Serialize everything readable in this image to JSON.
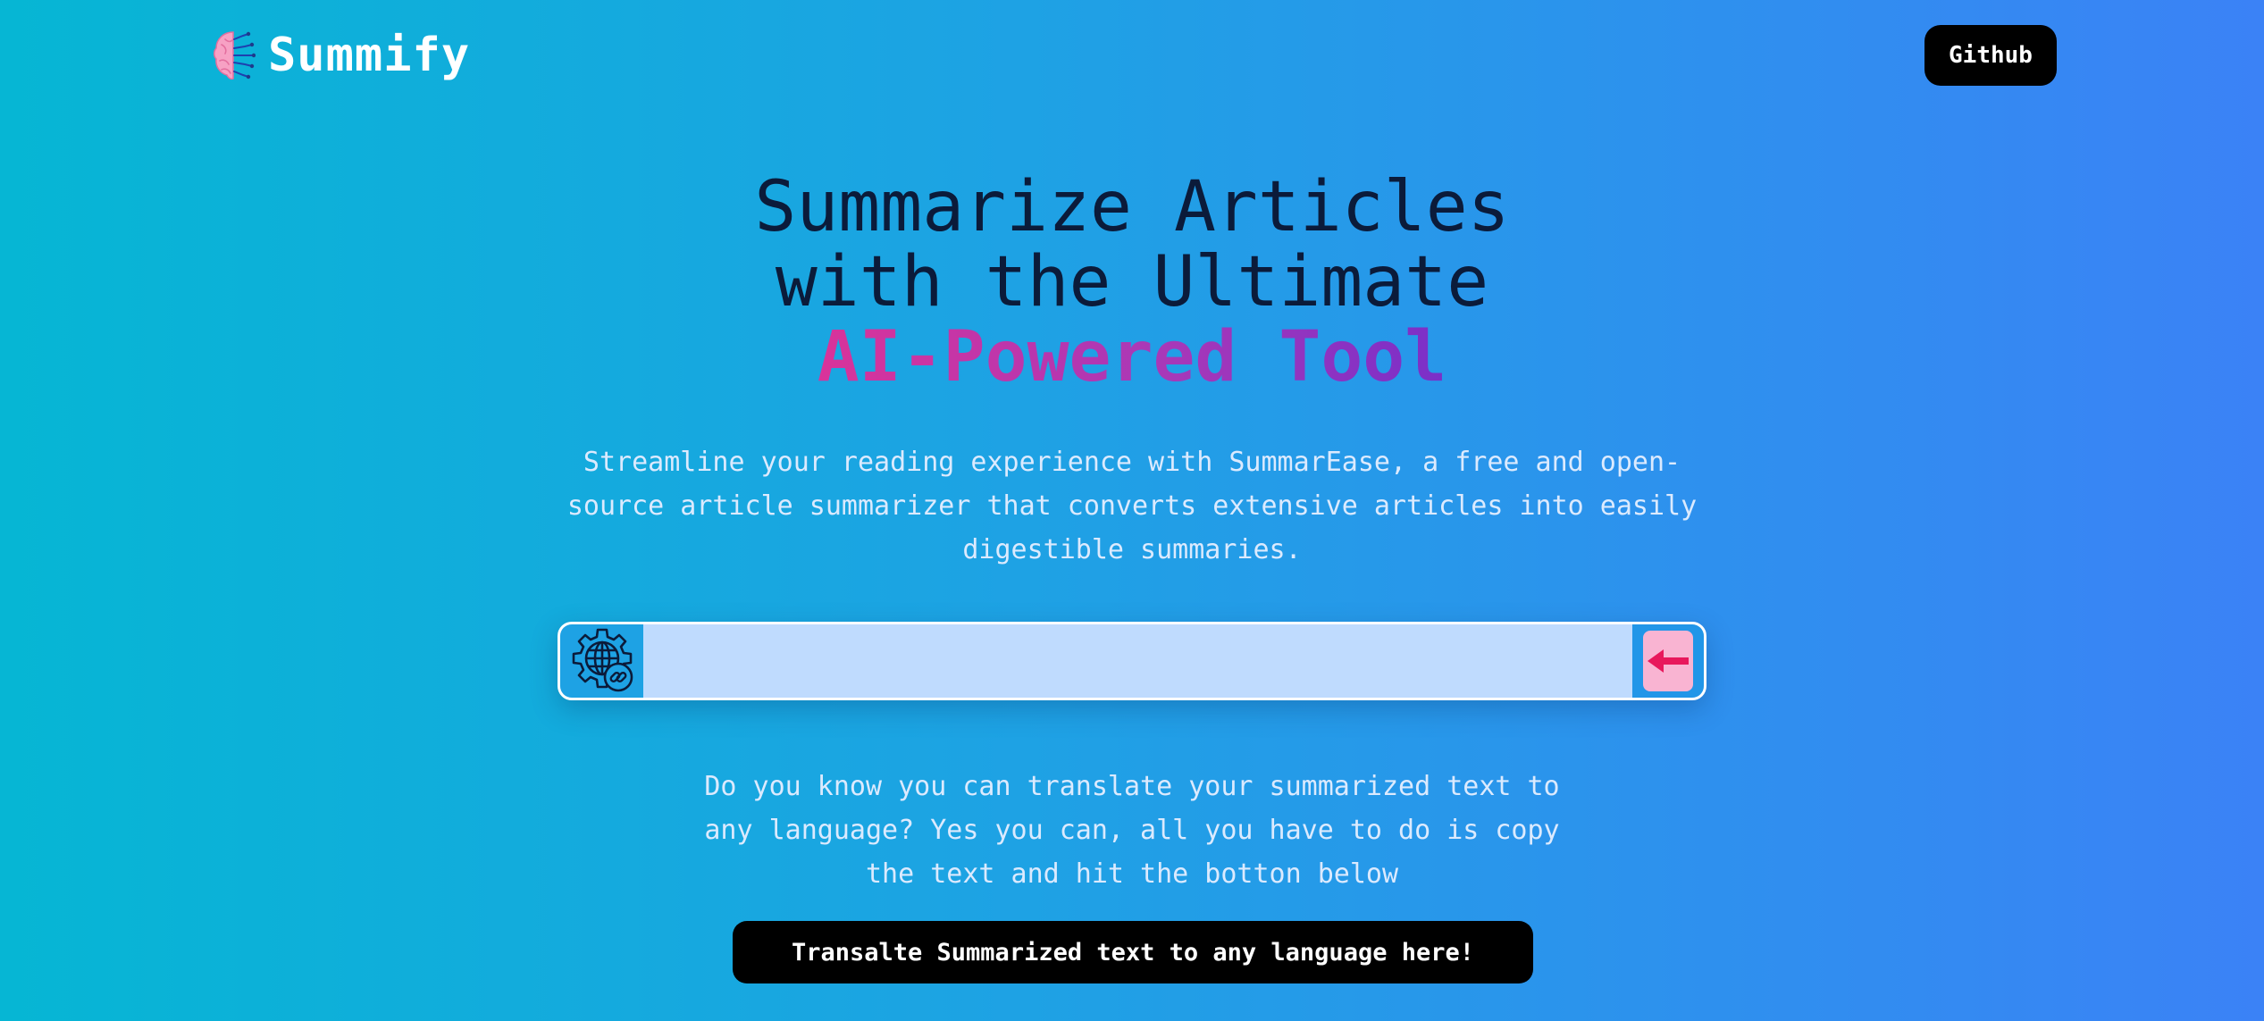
{
  "nav": {
    "brand_name": "Summify",
    "logo_icon": "brain-icon",
    "github_label": "Github"
  },
  "hero": {
    "title_line1": "Summarize Articles",
    "title_line2": "with the Ultimate",
    "title_accent": "AI-Powered Tool",
    "description": "Streamline your reading experience with SummarEase, a free and open-source article summarizer that converts extensive articles into easily digestible summaries."
  },
  "url_form": {
    "link_icon": "globe-link-gear-icon",
    "input_value": "",
    "input_placeholder": "",
    "submit_icon": "arrow-left-icon"
  },
  "translate": {
    "note": "Do you know you can translate your summarized text to any language? Yes you can, all you have to do is copy the text and hit the botton below",
    "button_label": "Transalte Summarized text to any language here!"
  },
  "colors": {
    "gradient_start": "#06b6d4",
    "gradient_end": "#3b82f6",
    "title_text": "#0b1b3a",
    "accent_start": "#d9339a",
    "accent_end": "#7a2fc8",
    "input_bg": "#bfdbfe",
    "submit_bg": "#f9b4d2",
    "submit_arrow": "#e8185c",
    "button_bg": "#000000"
  }
}
